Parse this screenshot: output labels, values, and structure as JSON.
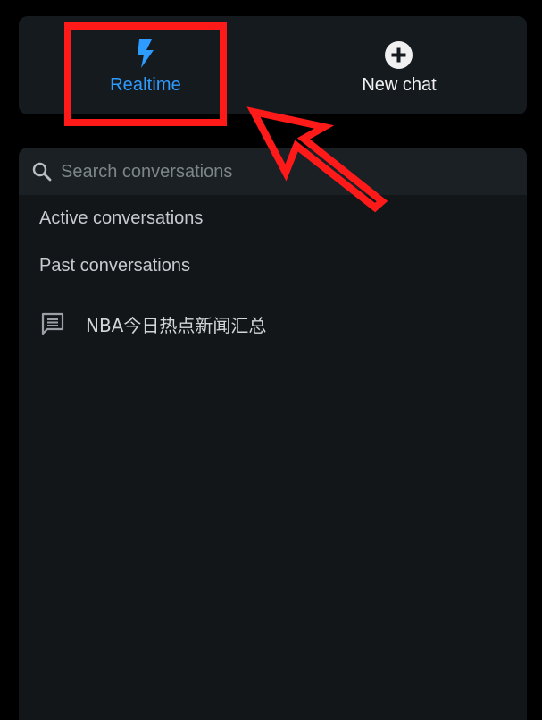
{
  "top_bar": {
    "realtime": {
      "label": "Realtime",
      "icon": "lightning-bolt-icon",
      "color": "#2e9bff"
    },
    "new_chat": {
      "label": "New chat",
      "icon": "plus-circle-icon"
    }
  },
  "search": {
    "placeholder": "Search conversations",
    "value": "",
    "icon": "search-icon"
  },
  "sections": {
    "active_label": "Active conversations",
    "past_label": "Past conversations"
  },
  "conversations": [
    {
      "title": "NBA今日热点新闻汇总",
      "icon": "chat-bubble-icon"
    }
  ],
  "annotation": {
    "highlight_color": "#ff1a1a"
  }
}
